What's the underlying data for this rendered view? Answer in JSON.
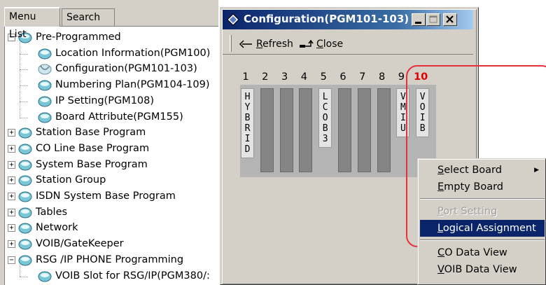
{
  "tabs": {
    "menu_list": "Menu List",
    "search": "Search"
  },
  "tree": [
    {
      "label": "Pre-Programmed",
      "expander": "−",
      "level": 0
    },
    {
      "label": "Location Information(PGM100)",
      "level": 1
    },
    {
      "label": "Configuration(PGM101-103)",
      "level": 1
    },
    {
      "label": "Numbering Plan(PGM104-109)",
      "level": 1
    },
    {
      "label": "IP Setting(PGM108)",
      "level": 1
    },
    {
      "label": "Board Attribute(PGM155)",
      "level": 1
    },
    {
      "label": "Station Base Program",
      "expander": "+",
      "level": 0
    },
    {
      "label": "CO Line Base Program",
      "expander": "+",
      "level": 0
    },
    {
      "label": "System Base Program",
      "expander": "+",
      "level": 0
    },
    {
      "label": "Station Group",
      "expander": "+",
      "level": 0
    },
    {
      "label": "ISDN System Base Program",
      "expander": "+",
      "level": 0
    },
    {
      "label": "Tables",
      "expander": "+",
      "level": 0
    },
    {
      "label": "Network",
      "expander": "+",
      "level": 0
    },
    {
      "label": "VOIB/GateKeeper",
      "expander": "+",
      "level": 0
    },
    {
      "label": "RSG /IP PHONE Programming",
      "expander": "−",
      "level": 0
    },
    {
      "label": "VOIB Slot for RSG/IP(PGM380/:",
      "level": 1
    }
  ],
  "window": {
    "title": "Configuration(PGM101-103)",
    "toolbar": {
      "refresh": "Refresh",
      "refresh_mnemonic": "R",
      "close": "Close",
      "close_mnemonic": "C"
    }
  },
  "slots": [
    {
      "number": "1",
      "board": "HYBRID"
    },
    {
      "number": "2",
      "board": ""
    },
    {
      "number": "3",
      "board": ""
    },
    {
      "number": "4",
      "board": ""
    },
    {
      "number": "5",
      "board": "LCOB3"
    },
    {
      "number": "6",
      "board": ""
    },
    {
      "number": "7",
      "board": ""
    },
    {
      "number": "8",
      "board": ""
    },
    {
      "number": "9",
      "board": "VMIU"
    },
    {
      "number": "10",
      "board": "VOIB",
      "highlight_color": "#e00000"
    }
  ],
  "context_menu": [
    {
      "label": "Select Board",
      "mnemonic": "S",
      "submenu": true
    },
    {
      "label": "Empty Board",
      "mnemonic": "E"
    },
    {
      "separator": true
    },
    {
      "label": "Port Setting",
      "mnemonic": "P",
      "disabled": true
    },
    {
      "label": "Logical Assignment",
      "mnemonic": "L",
      "highlighted": true
    },
    {
      "separator": true
    },
    {
      "label": "CO Data View",
      "mnemonic": "C"
    },
    {
      "label": "VOIB Data View",
      "mnemonic": "V"
    }
  ],
  "colors": {
    "titlebar": "#0a246a",
    "highlight": "#0a246a",
    "outline": "#e8303a",
    "slot_empty": "#858585"
  }
}
